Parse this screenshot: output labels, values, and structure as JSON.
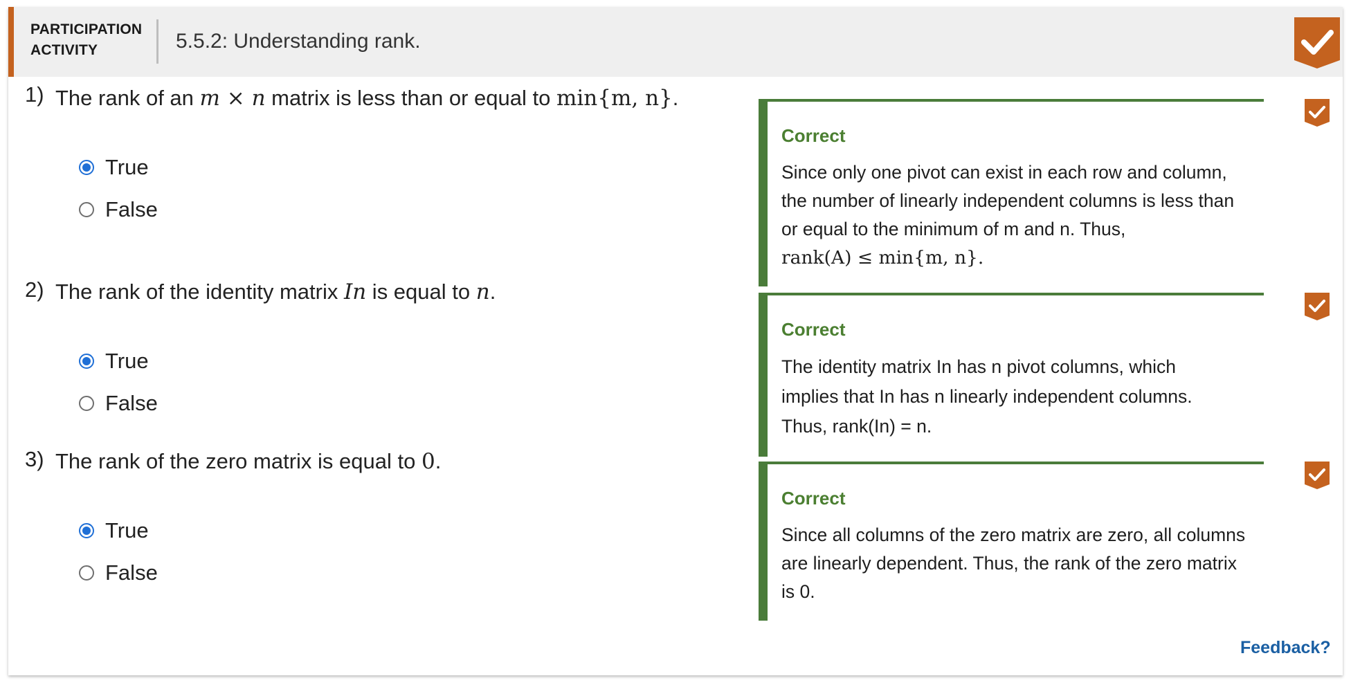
{
  "header": {
    "label_line1": "PARTICIPATION",
    "label_line2": "ACTIVITY",
    "title": "5.5.2: Understanding rank.",
    "completion_icon": "checkmark-icon",
    "accent_color": "#c4621f"
  },
  "questions": [
    {
      "number": "1)",
      "text_a": "The rank of an ",
      "math_a": "m × n",
      "text_b": " matrix is less than or equal to ",
      "math_b": "min{m, n}",
      "text_c": ".",
      "options": [
        {
          "label": "True",
          "selected": true
        },
        {
          "label": "False",
          "selected": false
        }
      ],
      "feedback": {
        "heading": "Correct",
        "lines": [
          "Since only one pivot can exist in each row and column,",
          "the number of linearly independent columns is less than",
          "or equal to the minimum of m and n. Thus,",
          "rank(A) ≤ min{m, n}."
        ]
      }
    },
    {
      "number": "2)",
      "text_a": "The rank of the identity matrix ",
      "math_a": "In",
      "text_b": " is equal to ",
      "math_b": "n",
      "text_c": ".",
      "options": [
        {
          "label": "True",
          "selected": true
        },
        {
          "label": "False",
          "selected": false
        }
      ],
      "feedback": {
        "heading": "Correct",
        "lines": [
          "The identity matrix In has n pivot columns, which",
          "implies that In has n linearly independent columns.",
          "Thus, rank(In) = n."
        ]
      }
    },
    {
      "number": "3)",
      "text_a": "The rank of the zero matrix is equal to ",
      "math_a": "0",
      "text_b": ".",
      "options": [
        {
          "label": "True",
          "selected": true
        },
        {
          "label": "False",
          "selected": false
        }
      ],
      "feedback": {
        "heading": "Correct",
        "lines": [
          "Since all columns of the zero matrix are zero, all columns",
          "are linearly dependent. Thus, the rank of the zero matrix",
          "is 0."
        ]
      }
    }
  ],
  "feedback_link": "Feedback?",
  "colors": {
    "correct_green": "#4a7c3a",
    "radio_blue": "#1f6fd6",
    "link_blue": "#1a5fa3",
    "check_orange": "#c4621f"
  }
}
